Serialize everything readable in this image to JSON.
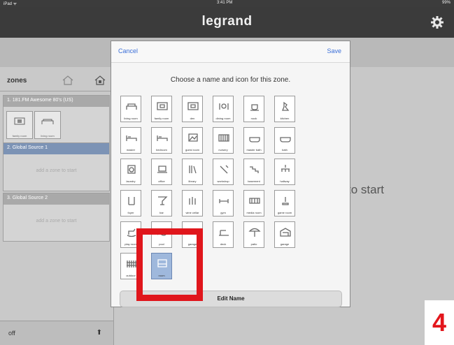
{
  "status": {
    "carrier": "iPad ᯤ",
    "time": "3:41 PM",
    "battery": "99%"
  },
  "navbar": {
    "title": "legrand"
  },
  "zones": {
    "title": "zones"
  },
  "sources": [
    {
      "title": "1. 181.FM Awesome 80's (US)",
      "items": [
        "family room",
        "living room"
      ],
      "add_text": ""
    },
    {
      "title": "2. Global Source 1",
      "items": [],
      "add_text": "add a zone to start"
    },
    {
      "title": "3. Global Source 2",
      "items": [],
      "add_text": "add a zone to start"
    }
  ],
  "footer": {
    "state": "off",
    "arrow": "⬆"
  },
  "background": {
    "text": "to start"
  },
  "modal": {
    "cancel": "Cancel",
    "save": "Save",
    "prompt": "Choose a name and icon for this zone.",
    "edit_name": "Edit Name",
    "icons": [
      {
        "label": "living room",
        "icon": "sofa-icon"
      },
      {
        "label": "family room",
        "icon": "tv-icon"
      },
      {
        "label": "den",
        "icon": "tv-icon"
      },
      {
        "label": "dining room",
        "icon": "dining-icon"
      },
      {
        "label": "nook",
        "icon": "cup-icon"
      },
      {
        "label": "kitchen",
        "icon": "mixer-icon"
      },
      {
        "label": "master",
        "icon": "bed-icon"
      },
      {
        "label": "bedroom",
        "icon": "bed-icon"
      },
      {
        "label": "guest room",
        "icon": "picture-icon"
      },
      {
        "label": "nursery",
        "icon": "crib-icon"
      },
      {
        "label": "master bath",
        "icon": "tub-icon"
      },
      {
        "label": "bath",
        "icon": "tub-icon"
      },
      {
        "label": "laundry",
        "icon": "washer-icon"
      },
      {
        "label": "office",
        "icon": "laptop-icon"
      },
      {
        "label": "library",
        "icon": "books-icon"
      },
      {
        "label": "workshop",
        "icon": "tools-icon"
      },
      {
        "label": "basement",
        "icon": "stairs-icon"
      },
      {
        "label": "hallway",
        "icon": "chandelier-icon"
      },
      {
        "label": "foyer",
        "icon": "coat-rack-icon"
      },
      {
        "label": "bar",
        "icon": "cocktail-icon"
      },
      {
        "label": "wine cellar",
        "icon": "bottles-icon"
      },
      {
        "label": "gym",
        "icon": "dumbbell-icon"
      },
      {
        "label": "media room",
        "icon": "film-icon"
      },
      {
        "label": "game room",
        "icon": "joystick-icon"
      },
      {
        "label": "play room",
        "icon": "rocking-horse-icon"
      },
      {
        "label": "pool",
        "icon": "pool-icon"
      },
      {
        "label": "garage",
        "icon": "car-icon"
      },
      {
        "label": "deck",
        "icon": "deck-icon"
      },
      {
        "label": "patio",
        "icon": "umbrella-icon"
      },
      {
        "label": "garage",
        "icon": "garage-icon"
      },
      {
        "label": "outdoor",
        "icon": "fence-icon"
      },
      {
        "label": "room",
        "icon": "room-icon",
        "selected": true
      }
    ]
  },
  "annotation": {
    "step": "4"
  },
  "colors": {
    "accent": "#3b6fd8",
    "highlight": "#e0161c",
    "selected": "#9fb8dc"
  }
}
